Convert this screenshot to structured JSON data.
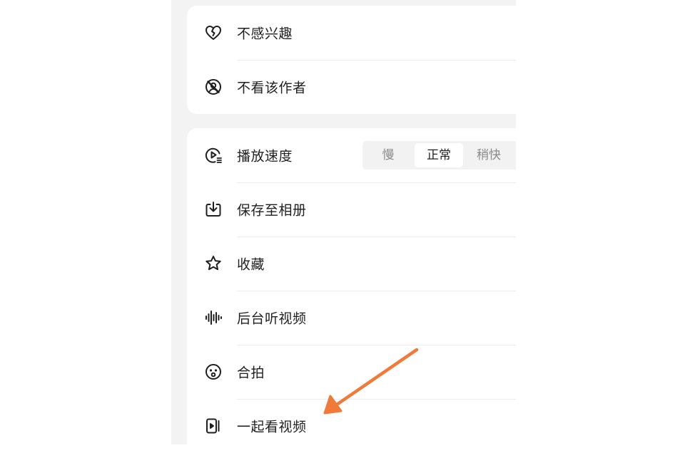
{
  "card_top": {
    "items": [
      {
        "label": "不感兴趣",
        "icon": "broken-heart-icon"
      },
      {
        "label": "不看该作者",
        "icon": "block-user-icon"
      }
    ]
  },
  "card_main": {
    "speed": {
      "label": "播放速度",
      "icon": "playback-speed-icon",
      "options": [
        "慢",
        "正常",
        "稍快"
      ],
      "selected": "正常"
    },
    "items": [
      {
        "label": "保存至相册",
        "icon": "download-icon"
      },
      {
        "label": "收藏",
        "icon": "star-icon"
      },
      {
        "label": "后台听视频",
        "icon": "audio-wave-icon"
      },
      {
        "label": "合拍",
        "icon": "duet-face-icon"
      },
      {
        "label": "一起看视频",
        "icon": "watch-together-icon"
      }
    ]
  },
  "colors": {
    "annotation_arrow": "#f07a3a",
    "background": "#f3f3f4",
    "card": "#ffffff",
    "text": "#1f1f1f",
    "muted_text": "#8a8a8a"
  }
}
